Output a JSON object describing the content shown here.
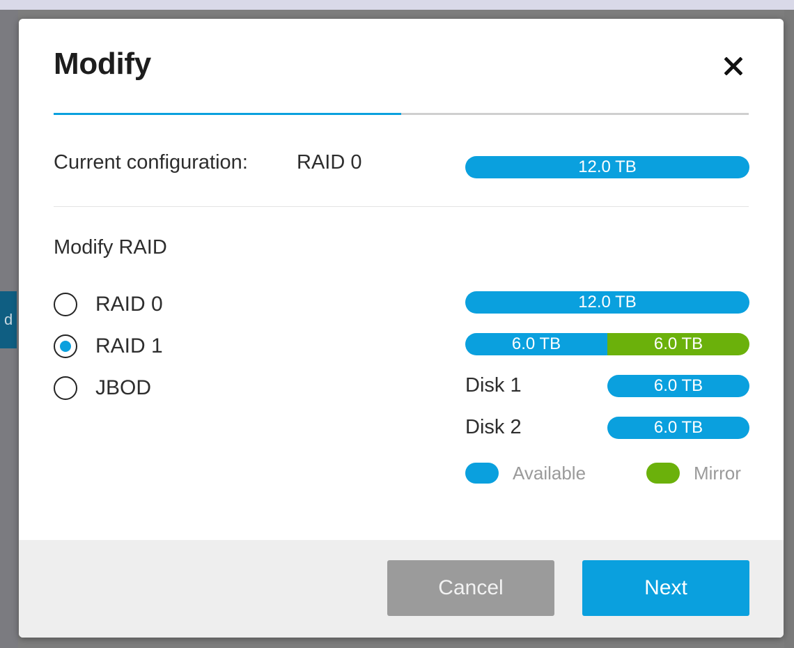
{
  "colors": {
    "accent": "#0aa0de",
    "mirror": "#6bb10b",
    "cancel": "#9b9b9b"
  },
  "modal": {
    "title": "Modify",
    "close_icon": "close-icon",
    "step_progress": 0.5
  },
  "current": {
    "label": "Current configuration:",
    "value": "RAID 0",
    "capacity": "12.0 TB"
  },
  "modify": {
    "heading": "Modify RAID",
    "options": [
      {
        "label": "RAID 0",
        "selected": false
      },
      {
        "label": "RAID 1",
        "selected": true
      },
      {
        "label": "JBOD",
        "selected": false
      }
    ],
    "selected": "RAID 1"
  },
  "preview": {
    "total": "12.0 TB",
    "split": {
      "available": "6.0 TB",
      "mirror": "6.0 TB"
    },
    "disks": [
      {
        "label": "Disk 1",
        "capacity": "6.0 TB"
      },
      {
        "label": "Disk 2",
        "capacity": "6.0 TB"
      }
    ]
  },
  "legend": {
    "available": "Available",
    "mirror": "Mirror"
  },
  "footer": {
    "cancel_label": "Cancel",
    "next_label": "Next"
  },
  "background": {
    "tab_fragment": "d"
  }
}
